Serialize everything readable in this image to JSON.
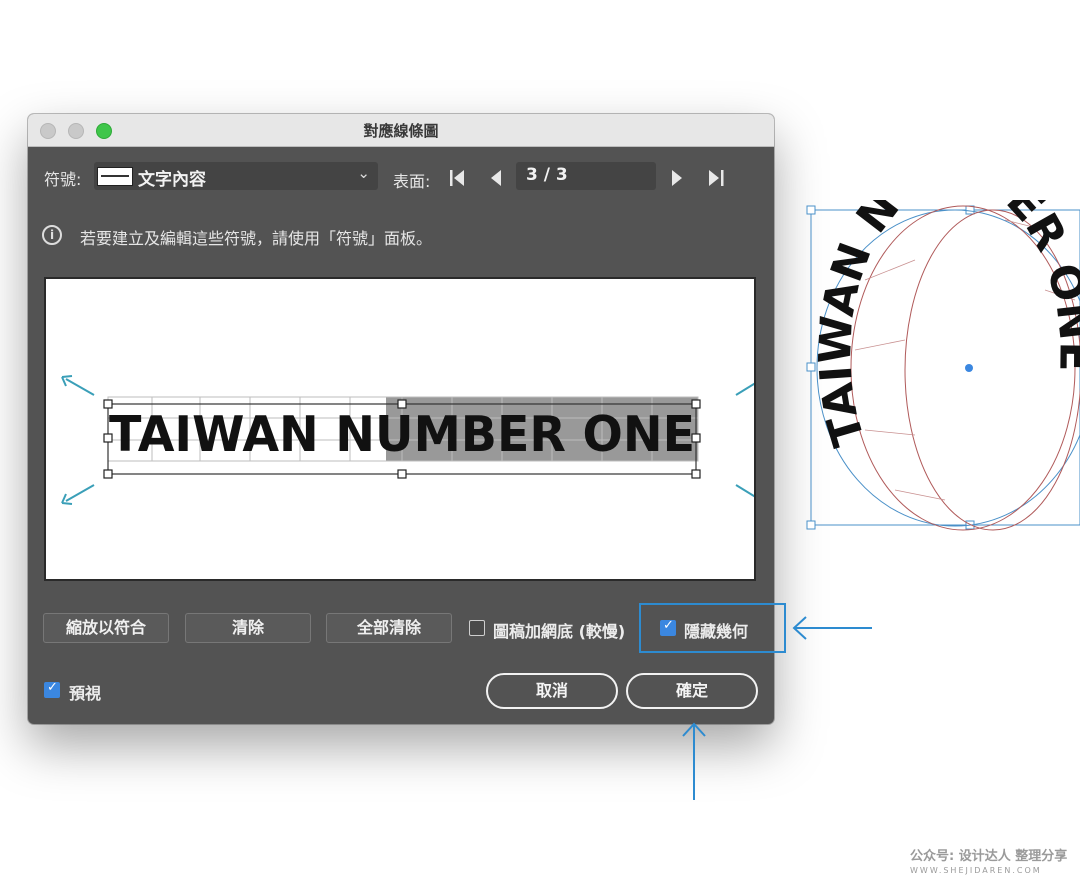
{
  "window": {
    "title": "對應線條圖"
  },
  "toolbar": {
    "symbol_label": "符號:",
    "symbol_value": "文字內容",
    "surface_label": "表面:",
    "page_value": "3 / 3"
  },
  "info": {
    "text": "若要建立及編輯這些符號，請使用「符號」面板。"
  },
  "preview": {
    "sample_text": "TAIWAN NUMBER ONE"
  },
  "buttons": {
    "scale_to_fit": "縮放以符合",
    "clear": "清除",
    "clear_all": "全部清除",
    "cancel": "取消",
    "ok": "確定"
  },
  "options": {
    "shade_artwork_label": "圖稿加網底 (較慢)",
    "shade_artwork_checked": false,
    "hide_geometry_label": "隱藏幾何",
    "hide_geometry_checked": true,
    "preview_label": "預視",
    "preview_checked": true
  },
  "artboard": {
    "ring_text": "TAIWAN NUMBER ONE"
  },
  "watermark": {
    "line1": "公众号: 设计达人 整理分享",
    "line2": "WWW.SHEJIDAREN.COM"
  },
  "colors": {
    "accent": "#3b87e0",
    "annotation": "#2d8bd0",
    "dialog_bg": "#535353"
  }
}
